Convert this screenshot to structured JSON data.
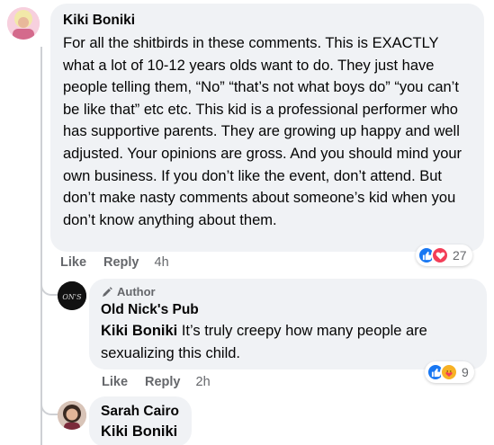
{
  "comments": [
    {
      "author": "Kiki Boniki",
      "text": "For all the shitbirds in these comments. This is EXACTLY what a lot of 10-12 years olds want to do. They just have people telling them, “No” “that’s not what boys do” “you can’t be like that” etc etc. This kid is a professional performer who has supportive parents. They are growing up happy and well adjusted. Your opinions are gross. And you should mind your own business. If you don’t like the event, don’t attend. But don’t make nasty comments about someone’s kid when you don’t know anything about them.",
      "like_label": "Like",
      "reply_label": "Reply",
      "time": "4h",
      "reaction_count": "27"
    },
    {
      "badge": "Author",
      "author": "Old Nick's Pub",
      "mention": "Kiki Boniki",
      "text": " It’s truly creepy how many people are sexualizing this child.",
      "like_label": "Like",
      "reply_label": "Reply",
      "time": "2h",
      "reaction_count": "9"
    },
    {
      "author": "Sarah Cairo",
      "mention": "Kiki Boniki"
    }
  ],
  "colors": {
    "like_blue": "#1877f2",
    "love_red": "#f33e58",
    "bubble_bg": "#f0f2f5",
    "meta_gray": "#65676b"
  }
}
